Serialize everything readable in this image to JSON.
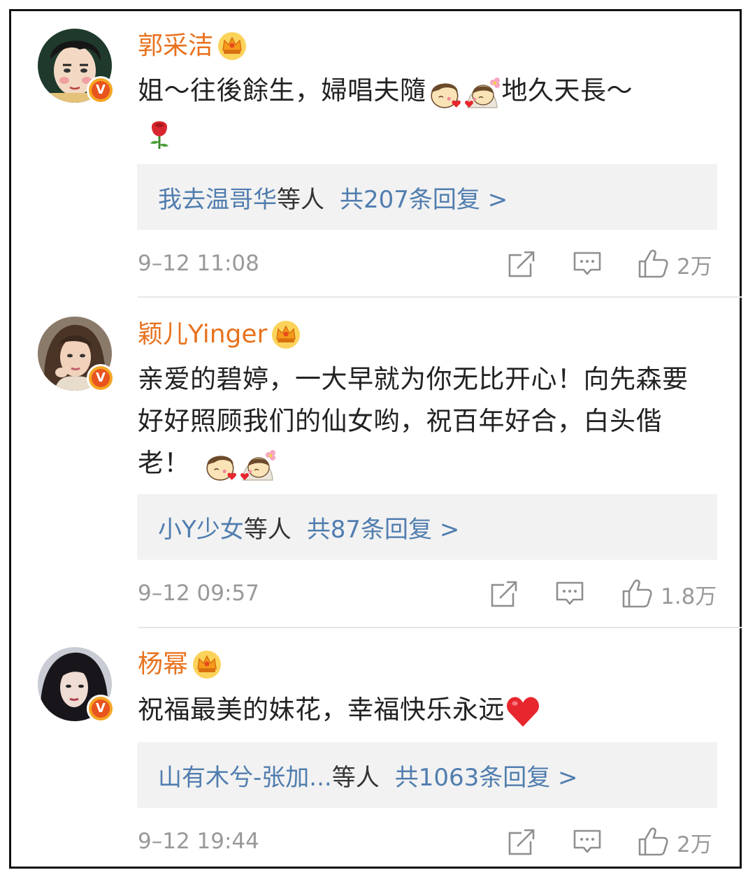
{
  "comments": [
    {
      "user": "郭采洁",
      "text_before": "姐～往後餘生，婦唱夫隨",
      "text_after": "地久天長～",
      "reply_users": "我去温哥华",
      "reply_etc": "等人",
      "reply_count": "共207条回复 >",
      "time": "9–12 11:08",
      "likes": "2万"
    },
    {
      "user": "颖儿Yinger",
      "text": "亲爱的碧婷，一大早就为你无比开心！向先森要好好照顾我们的仙女哟，祝百年好合，白头偕老！",
      "reply_users": "小Y少女",
      "reply_etc": "等人",
      "reply_count": "共87条回复 >",
      "time": "9–12 09:57",
      "likes": "1.8万"
    },
    {
      "user": "杨幂",
      "text": "祝福最美的妹花，幸福快乐永远",
      "reply_users": "山有木兮-张加...",
      "reply_etc": "等人",
      "reply_count": "共1063条回复 >",
      "time": "9–12 19:44",
      "likes": "2万"
    }
  ],
  "badge_letter": "V",
  "icons": [
    "crown-icon",
    "verified-badge-icon",
    "share-icon",
    "comment-icon",
    "like-icon",
    "kiss-boy-emoji",
    "bride-emoji",
    "rose-emoji",
    "heart-emoji"
  ],
  "colors": {
    "username": "#e8721e",
    "link": "#507daf",
    "meta": "#999999",
    "reply_bg": "#f2f2f2"
  }
}
